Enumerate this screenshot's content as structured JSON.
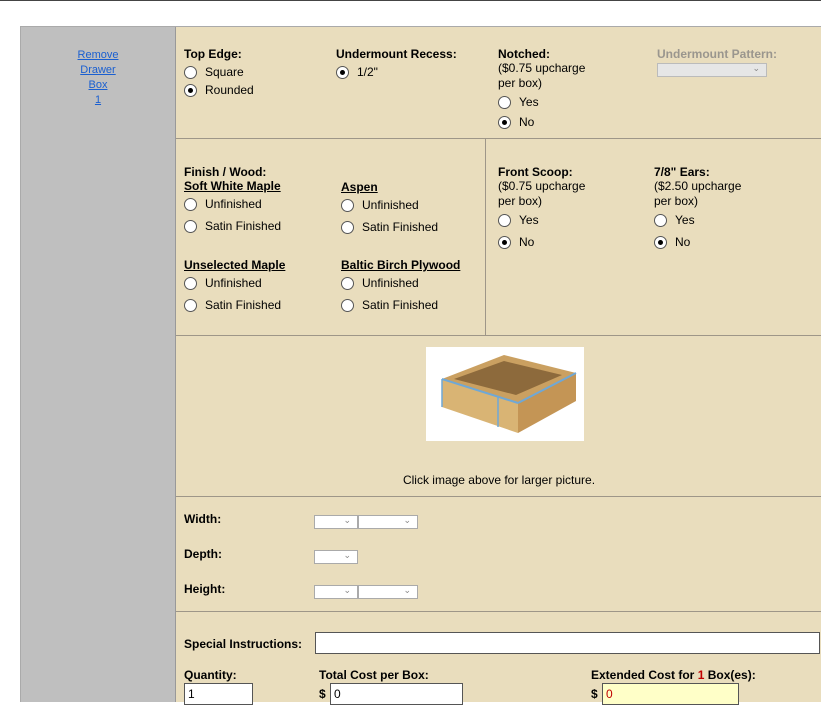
{
  "sidebar": {
    "remove_lines": [
      "Remove",
      "Drawer",
      "Box",
      "1"
    ]
  },
  "top_edge": {
    "label": "Top Edge:",
    "options": [
      "Square",
      "Rounded"
    ]
  },
  "undermount_recess": {
    "label": "Undermount Recess:",
    "option": "1/2\""
  },
  "notched": {
    "label": "Notched:",
    "note1": "($0.75 upcharge",
    "note2": "per box)",
    "options": [
      "Yes",
      "No"
    ]
  },
  "undermount_pattern": {
    "label": "Undermount Pattern:"
  },
  "finish": {
    "label": "Finish / Wood:",
    "soft_white_maple": {
      "title": "Soft White Maple",
      "options": [
        "Unfinished",
        "Satin Finished"
      ]
    },
    "aspen": {
      "title": "Aspen",
      "options": [
        "Unfinished",
        "Satin Finished"
      ]
    },
    "unselected_maple": {
      "title": "Unselected Maple",
      "options": [
        "Unfinished",
        "Satin Finished"
      ]
    },
    "baltic_birch": {
      "title": "Baltic Birch Plywood",
      "options": [
        "Unfinished",
        "Satin Finished"
      ]
    }
  },
  "front_scoop": {
    "label": "Front Scoop:",
    "note1": "($0.75 upcharge",
    "note2": "per box)",
    "options": [
      "Yes",
      "No"
    ]
  },
  "ears": {
    "label": "7/8\" Ears:",
    "note1": "($2.50 upcharge",
    "note2": "per box)",
    "options": [
      "Yes",
      "No"
    ]
  },
  "image_caption": "Click image above for larger picture.",
  "dimensions": {
    "width": "Width:",
    "depth": "Depth:",
    "height": "Height:"
  },
  "special_instructions": {
    "label": "Special Instructions:",
    "value": ""
  },
  "quantity": {
    "label": "Quantity:",
    "value": "1"
  },
  "total_cost": {
    "label": "Total Cost per Box:",
    "currency": "$",
    "value": "0"
  },
  "extended_cost": {
    "label_pre": "Extended Cost for",
    "count": "1",
    "label_post": "Box(es):",
    "currency": "$",
    "value": "0"
  },
  "colors": {
    "panel": "#e9ddbd",
    "sidebar": "#bfbfbf",
    "link": "#1a5fd0",
    "accent_red": "#c00000"
  }
}
